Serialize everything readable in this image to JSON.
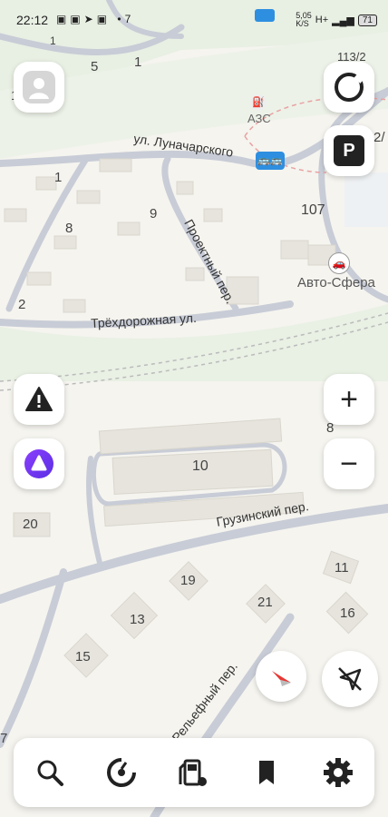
{
  "status_bar": {
    "time": "22:12",
    "network_speed": "5,05",
    "network_unit": "K/S",
    "signal": "H+",
    "battery": "71",
    "notification_count": "7"
  },
  "map": {
    "streets": [
      {
        "id": "lunacharskogo",
        "label": "ул. Луначарского"
      },
      {
        "id": "proektny",
        "label": "Проектный пер."
      },
      {
        "id": "tryokhdorozhnaya",
        "label": "Трёхдорожная ул."
      },
      {
        "id": "gruzinsky",
        "label": "Грузинский пер."
      },
      {
        "id": "relefny",
        "label": "Рельефный пер."
      }
    ],
    "pois": [
      {
        "id": "azs",
        "label": "АЗС"
      },
      {
        "id": "avto-sfera",
        "label": "Авто-Сфера"
      }
    ],
    "house_numbers": [
      "1",
      "5",
      "1",
      "1",
      "113/2",
      "2/",
      "1",
      "8",
      "9",
      "107",
      "2",
      "8",
      "10",
      "20",
      "11",
      "19",
      "21",
      "16",
      "13",
      "15",
      "7"
    ]
  },
  "controls": {
    "zoom_in": "+",
    "zoom_out": "−"
  },
  "icons": {
    "avatar": "avatar-icon",
    "compass": "compass-icon",
    "parking": "P",
    "alert": "road-alert-icon",
    "alice": "alice-voice-icon",
    "north": "north-arrow-icon",
    "location_off": "location-off-icon",
    "nav": [
      "search-icon",
      "music-icon",
      "fuel-icon",
      "bookmark-icon",
      "gear-icon"
    ]
  }
}
